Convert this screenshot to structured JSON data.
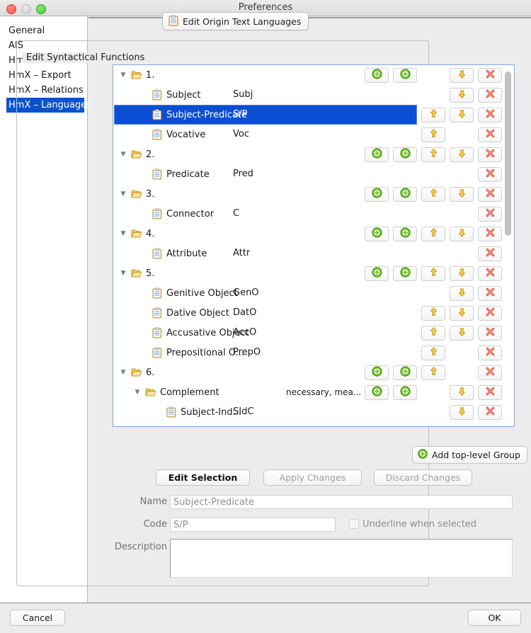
{
  "window": {
    "title": "Preferences",
    "traffic_lights": [
      "close-button",
      "minimize-button",
      "zoom-button"
    ]
  },
  "sidebar": {
    "items": [
      {
        "label": "General",
        "selected": false
      },
      {
        "label": "AIS",
        "selected": false
      },
      {
        "label": "HmX – General",
        "selected": false
      },
      {
        "label": "HmX – Export",
        "selected": false
      },
      {
        "label": "HmX – Relations",
        "selected": false
      },
      {
        "label": "HmX – Languages",
        "selected": true
      }
    ]
  },
  "main": {
    "edit_languages_button": "Edit Origin Text Languages",
    "group_title": "Edit Syntactical Functions",
    "add_top_level_group_button": "Add top-level Group",
    "edit_selection_button": "Edit Selection",
    "apply_changes_button": "Apply Changes",
    "discard_changes_button": "Discard Changes"
  },
  "tree": {
    "rows": [
      {
        "kind": "group",
        "indent": 0,
        "name": "1.",
        "code": "",
        "hint": "",
        "expanded": true,
        "selected": false,
        "buttons": [
          "add-group",
          "add-item",
          "move-down",
          "delete"
        ]
      },
      {
        "kind": "item",
        "indent": 1,
        "name": "Subject",
        "code": "Subj",
        "hint": "",
        "selected": false,
        "buttons": [
          "move-down",
          "delete"
        ]
      },
      {
        "kind": "item",
        "indent": 1,
        "name": "Subject-Predicate",
        "code": "S/P",
        "hint": "",
        "selected": true,
        "buttons": [
          "move-up",
          "move-down",
          "delete"
        ]
      },
      {
        "kind": "item",
        "indent": 1,
        "name": "Vocative",
        "code": "Voc",
        "hint": "",
        "selected": false,
        "buttons": [
          "move-up",
          "delete"
        ]
      },
      {
        "kind": "group",
        "indent": 0,
        "name": "2.",
        "code": "",
        "hint": "",
        "expanded": true,
        "selected": false,
        "buttons": [
          "add-group",
          "add-item",
          "move-up",
          "move-down",
          "delete"
        ]
      },
      {
        "kind": "item",
        "indent": 1,
        "name": "Predicate",
        "code": "Pred",
        "hint": "",
        "selected": false,
        "buttons": [
          "delete"
        ]
      },
      {
        "kind": "group",
        "indent": 0,
        "name": "3.",
        "code": "",
        "hint": "",
        "expanded": true,
        "selected": false,
        "buttons": [
          "add-group",
          "add-item",
          "move-up",
          "move-down",
          "delete"
        ]
      },
      {
        "kind": "item",
        "indent": 1,
        "name": "Connector",
        "code": "C",
        "hint": "",
        "selected": false,
        "buttons": [
          "delete"
        ]
      },
      {
        "kind": "group",
        "indent": 0,
        "name": "4.",
        "code": "",
        "hint": "",
        "expanded": true,
        "selected": false,
        "buttons": [
          "add-group",
          "add-item",
          "move-up",
          "move-down",
          "delete"
        ]
      },
      {
        "kind": "item",
        "indent": 1,
        "name": "Attribute",
        "code": "Attr",
        "hint": "",
        "selected": false,
        "buttons": [
          "delete"
        ]
      },
      {
        "kind": "group",
        "indent": 0,
        "name": "5.",
        "code": "",
        "hint": "",
        "expanded": true,
        "selected": false,
        "buttons": [
          "add-group",
          "add-item",
          "move-up",
          "move-down",
          "delete"
        ]
      },
      {
        "kind": "item",
        "indent": 1,
        "name": "Genitive Object",
        "code": "GenO",
        "hint": "",
        "selected": false,
        "buttons": [
          "move-down",
          "delete"
        ]
      },
      {
        "kind": "item",
        "indent": 1,
        "name": "Dative Object",
        "code": "DatO",
        "hint": "",
        "selected": false,
        "buttons": [
          "move-up",
          "move-down",
          "delete"
        ]
      },
      {
        "kind": "item",
        "indent": 1,
        "name": "Accusative Object",
        "code": "AccO",
        "hint": "",
        "selected": false,
        "buttons": [
          "move-up",
          "move-down",
          "delete"
        ]
      },
      {
        "kind": "item",
        "indent": 1,
        "name": "Prepositional O...",
        "code": "PrepO",
        "hint": "",
        "selected": false,
        "buttons": [
          "move-up",
          "delete"
        ]
      },
      {
        "kind": "group",
        "indent": 0,
        "name": "6.",
        "code": "",
        "hint": "",
        "expanded": true,
        "selected": false,
        "buttons": [
          "add-group",
          "add-item",
          "move-up",
          "delete"
        ]
      },
      {
        "kind": "group",
        "indent": 1,
        "name": "Complement",
        "code": "",
        "hint": "necessary, mea...",
        "expanded": true,
        "selected": false,
        "buttons": [
          "add-group",
          "add-item",
          "move-down",
          "delete"
        ]
      },
      {
        "kind": "item",
        "indent": 2,
        "name": "Subject-Ind...",
        "code": "SIdC",
        "hint": "",
        "selected": false,
        "buttons": [
          "move-down",
          "delete"
        ]
      }
    ]
  },
  "form": {
    "name_label": "Name",
    "name_value": "Subject-Predicate",
    "code_label": "Code",
    "code_value": "S/P",
    "underline_label": "Underline when selected",
    "underline_checked": false,
    "description_label": "Description",
    "description_value": ""
  },
  "footer": {
    "cancel_button": "Cancel",
    "ok_button": "OK"
  },
  "colors": {
    "selection_blue": "#0b4ed1",
    "sidebar_selection_blue": "#0b53ce",
    "window_bg": "#ececec",
    "tree_border": "#7fa9e0",
    "add_green": "#5ab52a",
    "arrow_yellow": "#f6c444",
    "delete_red": "#e05a4a",
    "folder_yellow": "#e9ae3a"
  }
}
